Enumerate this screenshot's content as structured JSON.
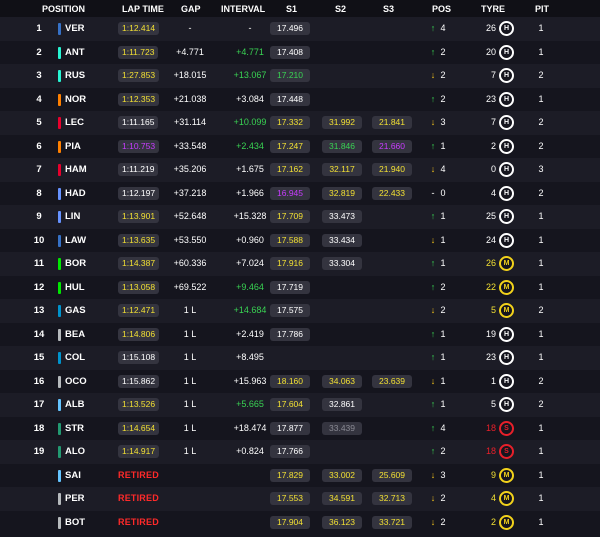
{
  "headers": {
    "position": "POSITION",
    "lap_time": "LAP TIME",
    "gap": "GAP",
    "interval": "INTERVAL",
    "s1": "S1",
    "s2": "S2",
    "s3": "S3",
    "pos": "POS",
    "tyre": "TYRE",
    "pit": "PIT"
  },
  "colors": {
    "background": "#15151e",
    "row_alt": "#1c1c26",
    "pill": "#34343f",
    "yellow": "#f2e033",
    "green": "#39d353",
    "purple": "#c83cff",
    "retired": "#ff2a2a",
    "grey": "#8a8a94",
    "tyre_hard": "#ffffff",
    "tyre_medium": "#f2d21b",
    "tyre_soft": "#e8202a"
  },
  "rows": [
    {
      "pos": "1",
      "code": "VER",
      "team_color": "#3671c6",
      "lap": "1:12.414",
      "lap_color": "yellow",
      "gap": "-",
      "interval": "-",
      "int_color": "white",
      "s1": "17.496",
      "s1_color": "white",
      "s2": "",
      "s2_color": "white",
      "s3": "",
      "s3_color": "white",
      "change": "4",
      "change_dir": "up",
      "tyre_laps": "26",
      "tyre_laps_color": "white",
      "tyre": "H",
      "tyre_color": "#ffffff",
      "pit": "1"
    },
    {
      "pos": "2",
      "code": "ANT",
      "team_color": "#27f4d2",
      "lap": "1:11.723",
      "lap_color": "yellow",
      "gap": "+4.771",
      "interval": "+4.771",
      "int_color": "green",
      "s1": "17.408",
      "s1_color": "white",
      "s2": "",
      "s2_color": "white",
      "s3": "",
      "s3_color": "white",
      "change": "2",
      "change_dir": "up",
      "tyre_laps": "20",
      "tyre_laps_color": "white",
      "tyre": "H",
      "tyre_color": "#ffffff",
      "pit": "1"
    },
    {
      "pos": "3",
      "code": "RUS",
      "team_color": "#27f4d2",
      "lap": "1:27.853",
      "lap_color": "yellow",
      "gap": "+18.015",
      "interval": "+13.067",
      "int_color": "green",
      "s1": "17.210",
      "s1_color": "green",
      "s2": "",
      "s2_color": "white",
      "s3": "",
      "s3_color": "white",
      "change": "2",
      "change_dir": "down",
      "tyre_laps": "7",
      "tyre_laps_color": "white",
      "tyre": "H",
      "tyre_color": "#ffffff",
      "pit": "2"
    },
    {
      "pos": "4",
      "code": "NOR",
      "team_color": "#ff8000",
      "lap": "1:12.353",
      "lap_color": "yellow",
      "gap": "+21.038",
      "interval": "+3.084",
      "int_color": "white",
      "s1": "17.448",
      "s1_color": "white",
      "s2": "",
      "s2_color": "white",
      "s3": "",
      "s3_color": "white",
      "change": "2",
      "change_dir": "up",
      "tyre_laps": "23",
      "tyre_laps_color": "white",
      "tyre": "H",
      "tyre_color": "#ffffff",
      "pit": "1"
    },
    {
      "pos": "5",
      "code": "LEC",
      "team_color": "#e8002d",
      "lap": "1:11.165",
      "lap_color": "white",
      "gap": "+31.114",
      "interval": "+10.099",
      "int_color": "green",
      "s1": "17.332",
      "s1_color": "yellow",
      "s2": "31.992",
      "s2_color": "yellow",
      "s3": "21.841",
      "s3_color": "yellow",
      "change": "3",
      "change_dir": "down",
      "tyre_laps": "7",
      "tyre_laps_color": "white",
      "tyre": "H",
      "tyre_color": "#ffffff",
      "pit": "2"
    },
    {
      "pos": "6",
      "code": "PIA",
      "team_color": "#ff8000",
      "lap": "1:10.753",
      "lap_color": "purple",
      "gap": "+33.548",
      "interval": "+2.434",
      "int_color": "green",
      "s1": "17.247",
      "s1_color": "yellow",
      "s2": "31.846",
      "s2_color": "green",
      "s3": "21.660",
      "s3_color": "purple",
      "change": "1",
      "change_dir": "up",
      "tyre_laps": "2",
      "tyre_laps_color": "white",
      "tyre": "H",
      "tyre_color": "#ffffff",
      "pit": "2"
    },
    {
      "pos": "7",
      "code": "HAM",
      "team_color": "#e8002d",
      "lap": "1:11.219",
      "lap_color": "white",
      "gap": "+35.206",
      "interval": "+1.675",
      "int_color": "white",
      "s1": "17.162",
      "s1_color": "yellow",
      "s2": "32.117",
      "s2_color": "yellow",
      "s3": "21.940",
      "s3_color": "yellow",
      "change": "4",
      "change_dir": "down",
      "tyre_laps": "0",
      "tyre_laps_color": "white",
      "tyre": "H",
      "tyre_color": "#ffffff",
      "pit": "3"
    },
    {
      "pos": "8",
      "code": "HAD",
      "team_color": "#6692ff",
      "lap": "1:12.197",
      "lap_color": "white",
      "gap": "+37.218",
      "interval": "+1.966",
      "int_color": "white",
      "s1": "16.945",
      "s1_color": "purple",
      "s2": "32.819",
      "s2_color": "yellow",
      "s3": "22.433",
      "s3_color": "yellow",
      "change": "0",
      "change_dir": "none",
      "tyre_laps": "4",
      "tyre_laps_color": "white",
      "tyre": "H",
      "tyre_color": "#ffffff",
      "pit": "2"
    },
    {
      "pos": "9",
      "code": "LIN",
      "team_color": "#6692ff",
      "lap": "1:13.901",
      "lap_color": "yellow",
      "gap": "+52.648",
      "interval": "+15.328",
      "int_color": "white",
      "s1": "17.709",
      "s1_color": "yellow",
      "s2": "33.473",
      "s2_color": "white",
      "s3": "",
      "s3_color": "white",
      "change": "1",
      "change_dir": "up",
      "tyre_laps": "25",
      "tyre_laps_color": "white",
      "tyre": "H",
      "tyre_color": "#ffffff",
      "pit": "1"
    },
    {
      "pos": "10",
      "code": "LAW",
      "team_color": "#3671c6",
      "lap": "1:13.635",
      "lap_color": "yellow",
      "gap": "+53.550",
      "interval": "+0.960",
      "int_color": "white",
      "s1": "17.588",
      "s1_color": "yellow",
      "s2": "33.434",
      "s2_color": "white",
      "s3": "",
      "s3_color": "white",
      "change": "1",
      "change_dir": "down",
      "tyre_laps": "24",
      "tyre_laps_color": "white",
      "tyre": "H",
      "tyre_color": "#ffffff",
      "pit": "1"
    },
    {
      "pos": "11",
      "code": "BOR",
      "team_color": "#00e701",
      "lap": "1:14.387",
      "lap_color": "yellow",
      "gap": "+60.336",
      "interval": "+7.024",
      "int_color": "white",
      "s1": "17.916",
      "s1_color": "yellow",
      "s2": "33.304",
      "s2_color": "white",
      "s3": "",
      "s3_color": "white",
      "change": "1",
      "change_dir": "up",
      "tyre_laps": "26",
      "tyre_laps_color": "yellow",
      "tyre": "M",
      "tyre_color": "#f2d21b",
      "pit": "1"
    },
    {
      "pos": "12",
      "code": "HUL",
      "team_color": "#00e701",
      "lap": "1:13.058",
      "lap_color": "yellow",
      "gap": "+69.522",
      "interval": "+9.464",
      "int_color": "green",
      "s1": "17.719",
      "s1_color": "white",
      "s2": "",
      "s2_color": "white",
      "s3": "",
      "s3_color": "white",
      "change": "2",
      "change_dir": "up",
      "tyre_laps": "22",
      "tyre_laps_color": "yellow",
      "tyre": "M",
      "tyre_color": "#f2d21b",
      "pit": "1"
    },
    {
      "pos": "13",
      "code": "GAS",
      "team_color": "#0093cc",
      "lap": "1:12.471",
      "lap_color": "yellow",
      "gap": "1 L",
      "interval": "+14.684",
      "int_color": "green",
      "s1": "17.575",
      "s1_color": "white",
      "s2": "",
      "s2_color": "white",
      "s3": "",
      "s3_color": "white",
      "change": "2",
      "change_dir": "down",
      "tyre_laps": "5",
      "tyre_laps_color": "yellow",
      "tyre": "M",
      "tyre_color": "#f2d21b",
      "pit": "2"
    },
    {
      "pos": "14",
      "code": "BEA",
      "team_color": "#b6babd",
      "lap": "1:14.806",
      "lap_color": "yellow",
      "gap": "1 L",
      "interval": "+2.419",
      "int_color": "white",
      "s1": "17.786",
      "s1_color": "white",
      "s2": "",
      "s2_color": "white",
      "s3": "",
      "s3_color": "white",
      "change": "1",
      "change_dir": "up",
      "tyre_laps": "19",
      "tyre_laps_color": "white",
      "tyre": "H",
      "tyre_color": "#ffffff",
      "pit": "1"
    },
    {
      "pos": "15",
      "code": "COL",
      "team_color": "#0093cc",
      "lap": "1:15.108",
      "lap_color": "white",
      "gap": "1 L",
      "interval": "+8.495",
      "int_color": "white",
      "s1": "",
      "s1_color": "white",
      "s2": "",
      "s2_color": "white",
      "s3": "",
      "s3_color": "white",
      "change": "1",
      "change_dir": "up",
      "tyre_laps": "23",
      "tyre_laps_color": "white",
      "tyre": "H",
      "tyre_color": "#ffffff",
      "pit": "1"
    },
    {
      "pos": "16",
      "code": "OCO",
      "team_color": "#b6babd",
      "lap": "1:15.862",
      "lap_color": "white",
      "gap": "1 L",
      "interval": "+15.963",
      "int_color": "white",
      "s1": "18.160",
      "s1_color": "yellow",
      "s2": "34.063",
      "s2_color": "yellow",
      "s3": "23.639",
      "s3_color": "yellow",
      "change": "1",
      "change_dir": "down",
      "tyre_laps": "1",
      "tyre_laps_color": "white",
      "tyre": "H",
      "tyre_color": "#ffffff",
      "pit": "2"
    },
    {
      "pos": "17",
      "code": "ALB",
      "team_color": "#64c4ff",
      "lap": "1:13.526",
      "lap_color": "yellow",
      "gap": "1 L",
      "interval": "+5.665",
      "int_color": "green",
      "s1": "17.604",
      "s1_color": "yellow",
      "s2": "32.861",
      "s2_color": "white",
      "s3": "",
      "s3_color": "white",
      "change": "1",
      "change_dir": "up",
      "tyre_laps": "5",
      "tyre_laps_color": "white",
      "tyre": "H",
      "tyre_color": "#ffffff",
      "pit": "2"
    },
    {
      "pos": "18",
      "code": "STR",
      "team_color": "#229971",
      "lap": "1:14.654",
      "lap_color": "yellow",
      "gap": "1 L",
      "interval": "+18.474",
      "int_color": "white",
      "s1": "17.877",
      "s1_color": "white",
      "s2": "33.439",
      "s2_color": "grey",
      "s3": "",
      "s3_color": "white",
      "change": "4",
      "change_dir": "up",
      "tyre_laps": "18",
      "tyre_laps_color": "red",
      "tyre": "S",
      "tyre_color": "#e8202a",
      "pit": "1"
    },
    {
      "pos": "19",
      "code": "ALO",
      "team_color": "#229971",
      "lap": "1:14.917",
      "lap_color": "yellow",
      "gap": "1 L",
      "interval": "+0.824",
      "int_color": "white",
      "s1": "17.766",
      "s1_color": "white",
      "s2": "",
      "s2_color": "white",
      "s3": "",
      "s3_color": "white",
      "change": "2",
      "change_dir": "up",
      "tyre_laps": "18",
      "tyre_laps_color": "red",
      "tyre": "S",
      "tyre_color": "#e8202a",
      "pit": "1"
    },
    {
      "pos": "",
      "code": "SAI",
      "team_color": "#64c4ff",
      "retired": "RETIRED",
      "lap": "",
      "lap_color": "white",
      "gap": "",
      "interval": "",
      "int_color": "white",
      "s1": "17.829",
      "s1_color": "yellow",
      "s2": "33.002",
      "s2_color": "yellow",
      "s3": "25.609",
      "s3_color": "yellow",
      "change": "3",
      "change_dir": "down",
      "tyre_laps": "9",
      "tyre_laps_color": "yellow",
      "tyre": "M",
      "tyre_color": "#f2d21b",
      "pit": "1"
    },
    {
      "pos": "",
      "code": "PER",
      "team_color": "#b6babd",
      "retired": "RETIRED",
      "lap": "",
      "lap_color": "white",
      "gap": "",
      "interval": "",
      "int_color": "white",
      "s1": "17.553",
      "s1_color": "yellow",
      "s2": "34.591",
      "s2_color": "yellow",
      "s3": "32.713",
      "s3_color": "yellow",
      "change": "2",
      "change_dir": "down",
      "tyre_laps": "4",
      "tyre_laps_color": "yellow",
      "tyre": "M",
      "tyre_color": "#f2d21b",
      "pit": "1"
    },
    {
      "pos": "",
      "code": "BOT",
      "team_color": "#b6babd",
      "retired": "RETIRED",
      "lap": "",
      "lap_color": "white",
      "gap": "",
      "interval": "",
      "int_color": "white",
      "s1": "17.904",
      "s1_color": "yellow",
      "s2": "36.123",
      "s2_color": "yellow",
      "s3": "33.721",
      "s3_color": "yellow",
      "change": "2",
      "change_dir": "down",
      "tyre_laps": "2",
      "tyre_laps_color": "yellow",
      "tyre": "M",
      "tyre_color": "#f2d21b",
      "pit": "1"
    }
  ]
}
